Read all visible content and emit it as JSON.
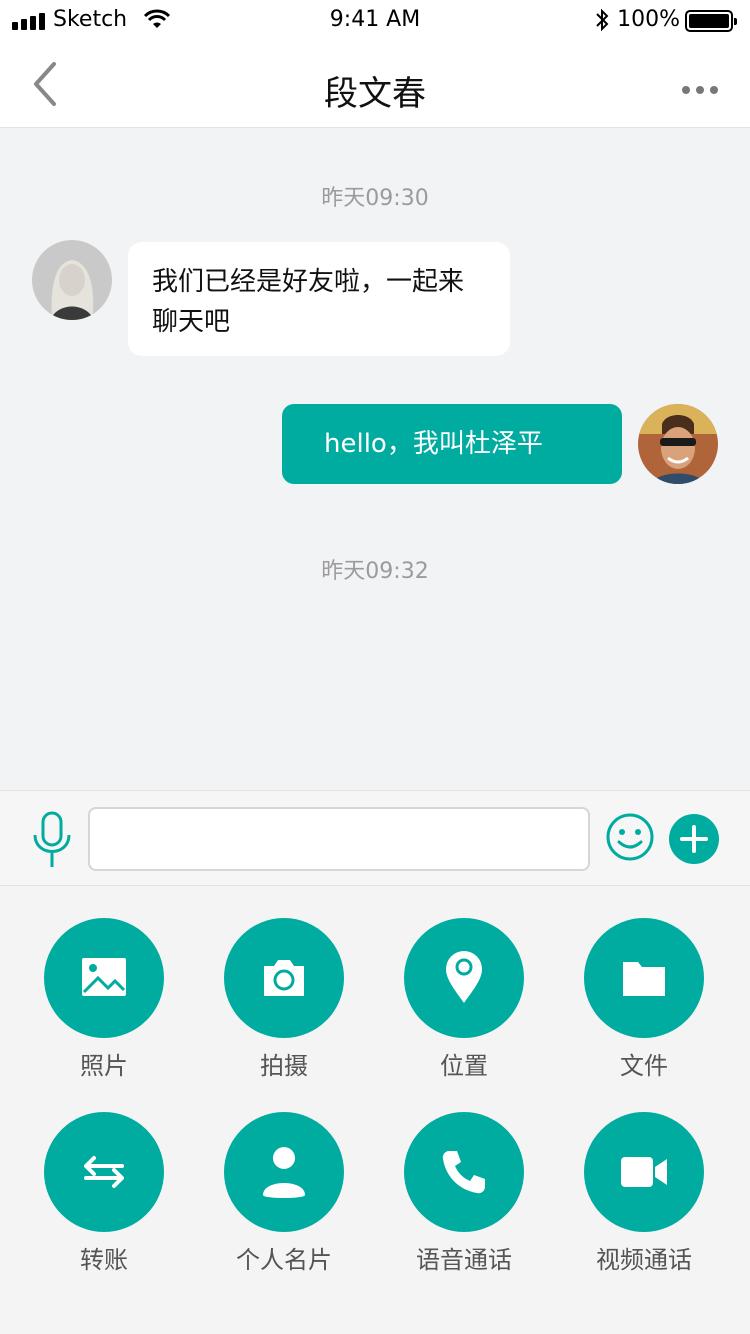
{
  "status_bar": {
    "carrier": "Sketch",
    "time": "9:41 AM",
    "battery": "100%"
  },
  "nav": {
    "title": "段文春"
  },
  "messages": {
    "timestamp_1": "昨天09:30",
    "incoming_text": "我们已经是好友啦，一起来聊天吧",
    "outgoing_text": "hello，我叫杜泽平",
    "timestamp_2": "昨天09:32"
  },
  "input": {
    "placeholder": ""
  },
  "actions": [
    {
      "label": "照片",
      "icon": "image-icon"
    },
    {
      "label": "拍摄",
      "icon": "camera-icon"
    },
    {
      "label": "位置",
      "icon": "location-pin-icon"
    },
    {
      "label": "文件",
      "icon": "folder-icon"
    },
    {
      "label": "转账",
      "icon": "transfer-icon"
    },
    {
      "label": "个人名片",
      "icon": "contact-card-icon"
    },
    {
      "label": "语音通话",
      "icon": "phone-icon"
    },
    {
      "label": "视频通话",
      "icon": "video-icon"
    }
  ],
  "colors": {
    "accent": "#00ab9f",
    "background": "#f2f3f5",
    "timestamp": "#9b9b9b"
  }
}
